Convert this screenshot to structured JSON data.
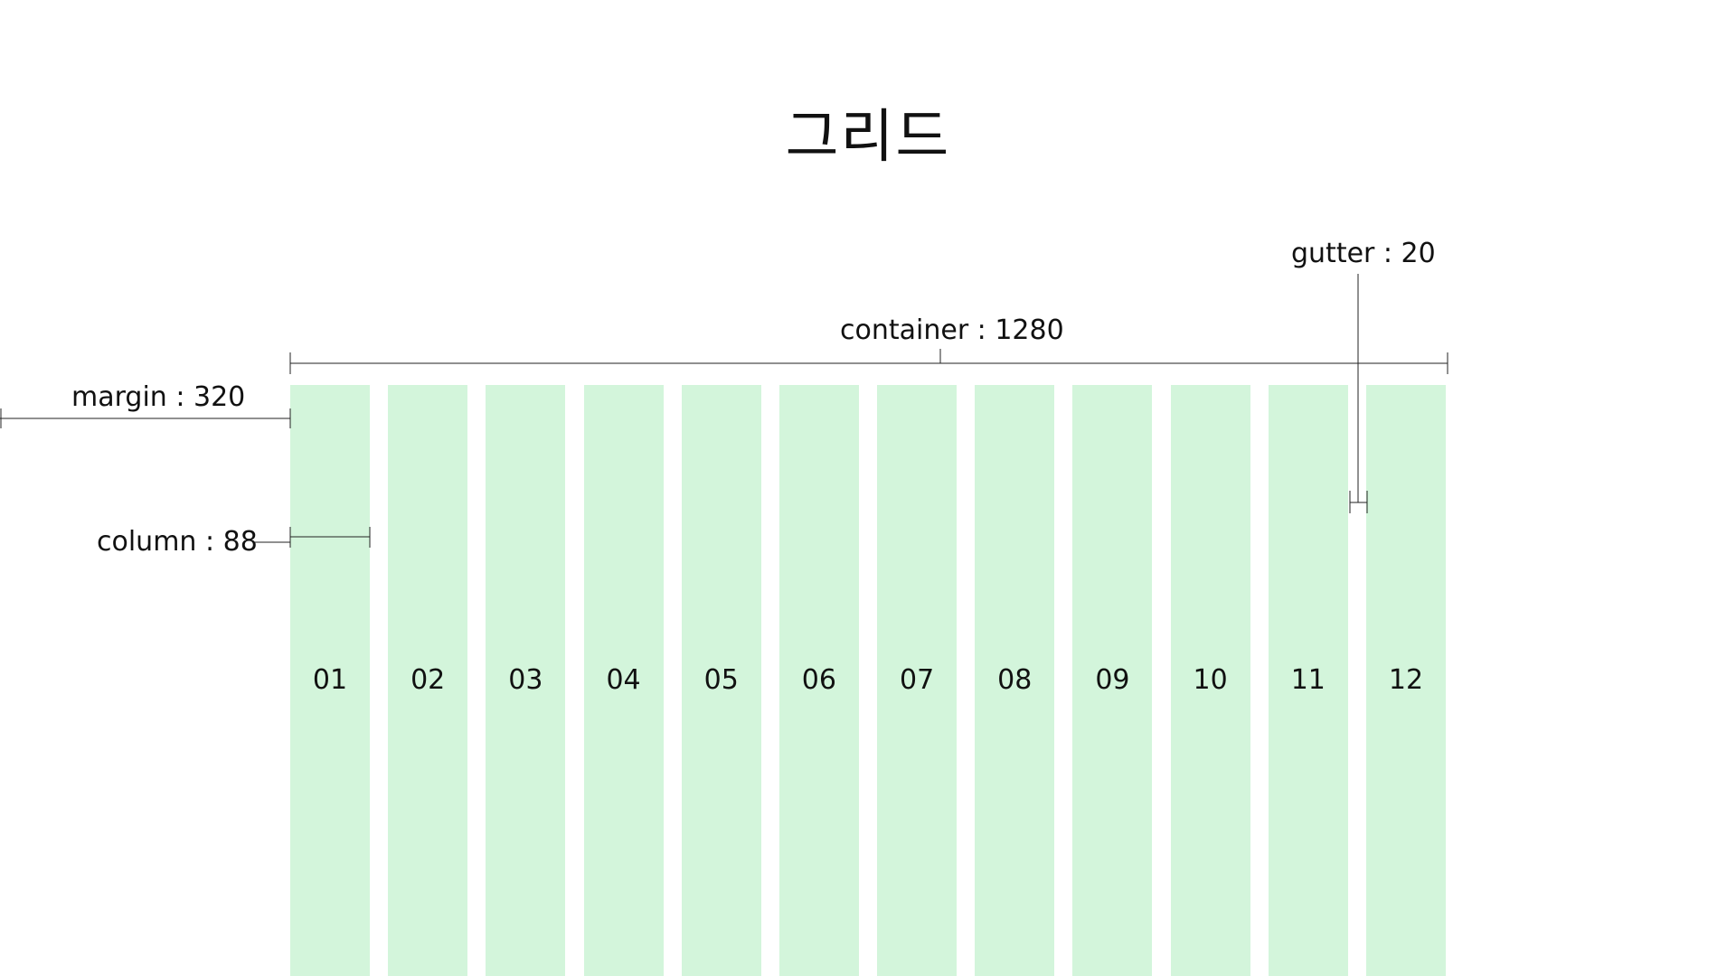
{
  "title": "그리드",
  "labels": {
    "container": "container : 1280",
    "margin": "margin : 320",
    "column": "column : 88",
    "gutter": "gutter : 20"
  },
  "columns": [
    "01",
    "02",
    "03",
    "04",
    "05",
    "06",
    "07",
    "08",
    "09",
    "10",
    "11",
    "12"
  ],
  "colors": {
    "column_fill": "#d3f5db",
    "line": "#222222",
    "text": "#111111"
  }
}
